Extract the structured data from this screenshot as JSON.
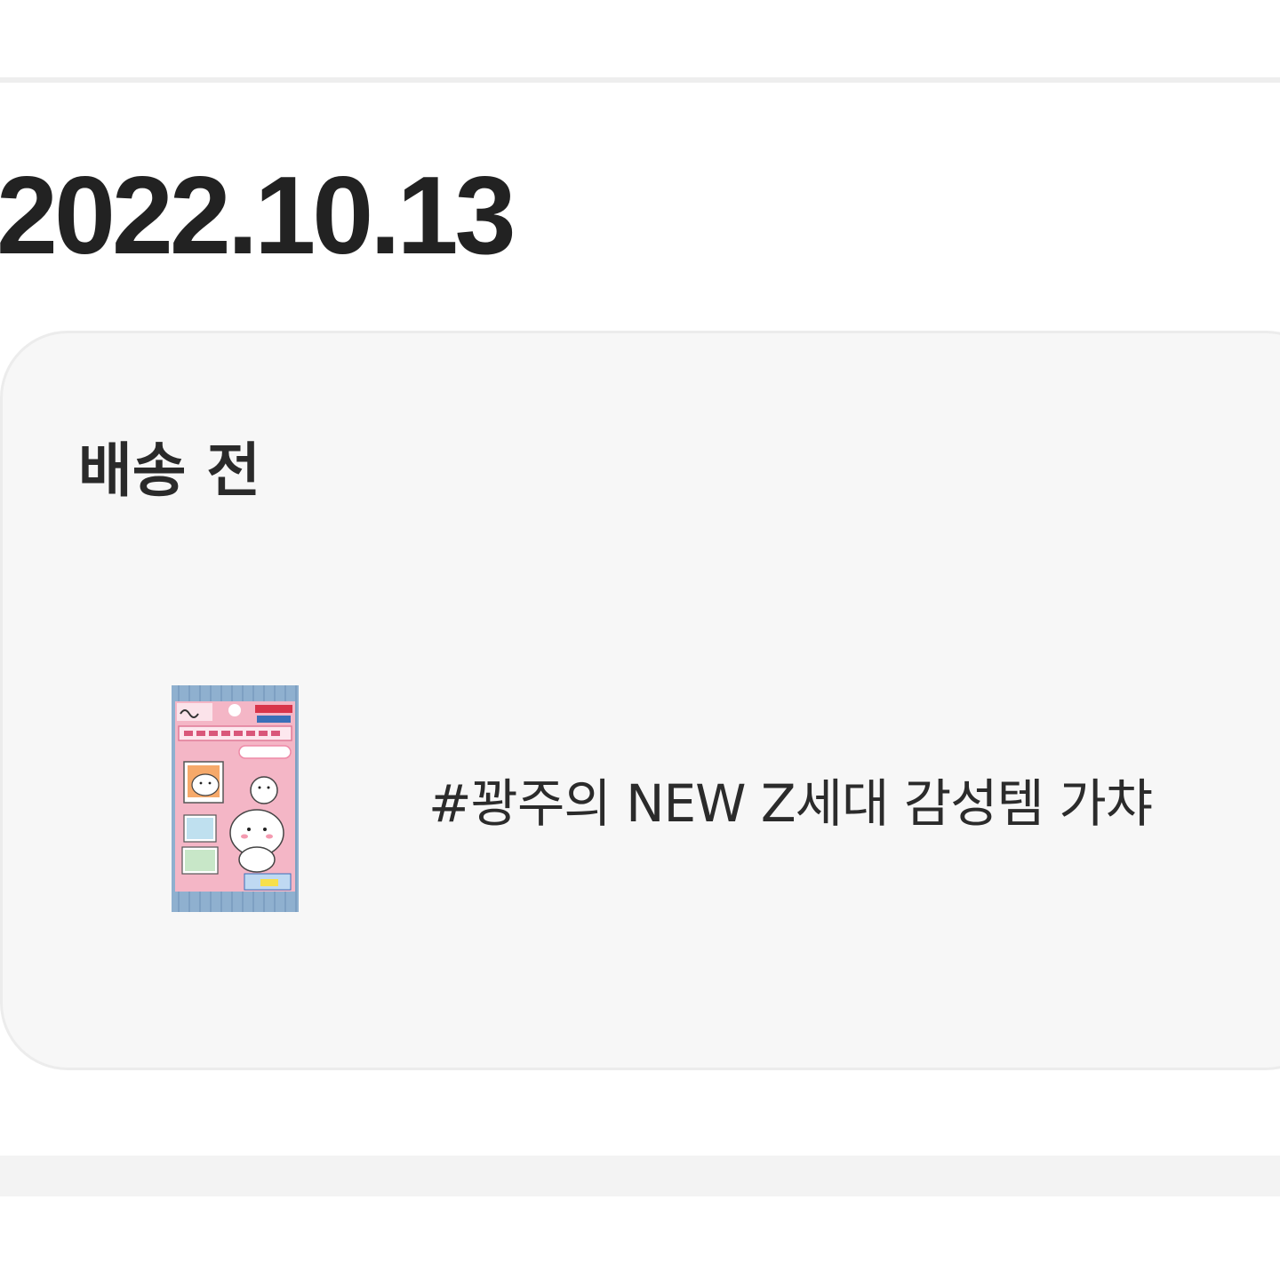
{
  "order": {
    "date": "2022.10.13",
    "status": "배송 전",
    "item": {
      "name": "#꽝주의 NEW Z세대 감성템 가챠",
      "thumbnail": "sticker-pack-image"
    }
  }
}
